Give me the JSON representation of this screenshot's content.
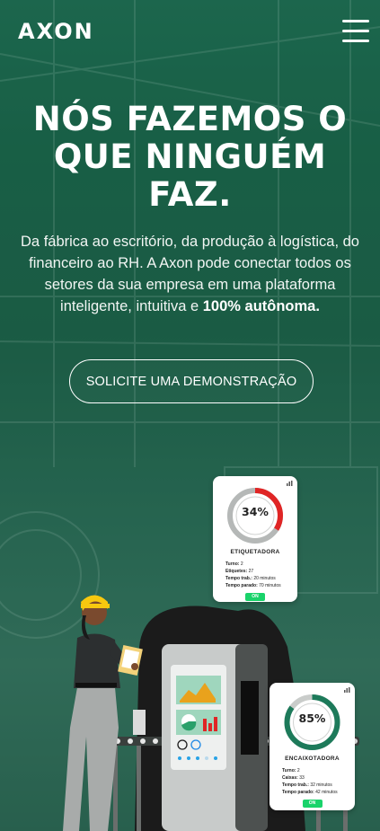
{
  "header": {
    "logo": "AXON",
    "menu_icon": "hamburger-menu-icon"
  },
  "hero": {
    "headline": "NÓS FAZEMOS O QUE NINGUÉM FAZ.",
    "body_text": "Da fábrica ao escritório, da produção à logística, do financeiro ao RH. A Axon pode conectar todos os setores da sua empresa em uma plataforma inteligente, intuitiva e ",
    "body_highlight": "100% autônoma.",
    "cta_label": "SOLICITE UMA DEMONSTRAÇÃO"
  },
  "machines": [
    {
      "name": "ETIQUETADORA",
      "percent_label": "34%",
      "percent": 34,
      "ring_color": "#e02525",
      "labels": {
        "turno": "Turno:",
        "itens": "Etiquetes:",
        "tempo_trab": "Tempo trab.:",
        "tempo_parado": "Tempo parado:"
      },
      "values": {
        "turno": "2",
        "itens": "27",
        "tempo_trab": "20 minutos",
        "tempo_parado": "70 minutos"
      },
      "status": "ON"
    },
    {
      "name": "ENCAIXOTADORA",
      "percent_label": "85%",
      "percent": 85,
      "ring_color": "#1d7a5a",
      "labels": {
        "turno": "Turno:",
        "itens": "Caixas:",
        "tempo_trab": "Tempo trab.:",
        "tempo_parado": "Tempo parado:"
      },
      "values": {
        "turno": "2",
        "itens": "33",
        "tempo_trab": "32 minutos",
        "tempo_parado": "42 minutos"
      },
      "status": "ON"
    }
  ],
  "colors": {
    "brand_green": "#1f6e53",
    "status_on": "#19d36a",
    "helmet": "#f7c80f"
  }
}
